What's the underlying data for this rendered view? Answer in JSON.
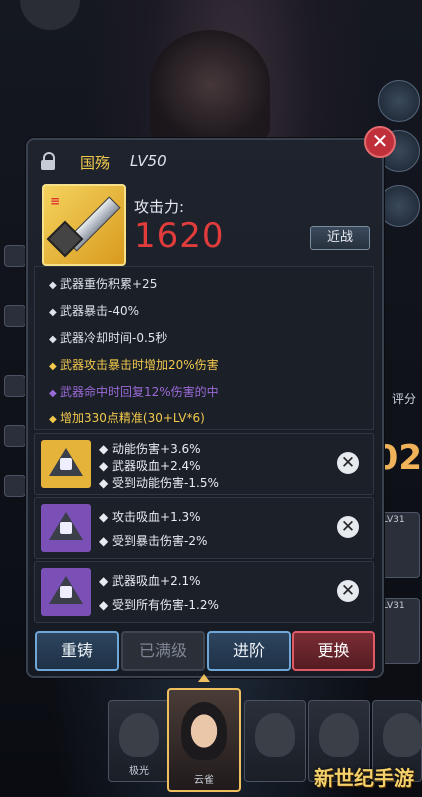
{
  "weapon": {
    "name": "国殇",
    "level": "LV50",
    "attack_label": "攻击力:",
    "attack_value": "1620",
    "type_badge": "近战"
  },
  "attributes": [
    {
      "text": "武器重伤积累+25",
      "color": "#dfe3ea",
      "bullet": "◆"
    },
    {
      "text": "武器暴击-40%",
      "color": "#dfe3ea",
      "bullet": "◆"
    },
    {
      "text": "武器冷却时间-0.5秒",
      "color": "#dfe3ea",
      "bullet": "◆"
    },
    {
      "text": "武器攻击暴击时增加20%伤害",
      "color": "#f2c94c",
      "bullet": "◆"
    },
    {
      "text": "武器命中时回复12%伤害的中",
      "color": "#9b6ad6",
      "bullet": "◆"
    },
    {
      "text": "增加330点精准(30+LV*6)",
      "color": "#f2c94c",
      "bullet": "◆"
    }
  ],
  "gems": [
    {
      "color": "#e6b33a",
      "lines": [
        "动能伤害+3.6%",
        "武器吸血+2.4%",
        "受到动能伤害-1.5%"
      ]
    },
    {
      "color": "#7a4fb6",
      "lines": [
        "攻击吸血+1.3%",
        "受到暴击伤害-2%"
      ]
    },
    {
      "color": "#7a4fb6",
      "lines": [
        "武器吸血+2.1%",
        "受到所有伤害-1.2%"
      ]
    }
  ],
  "buttons": {
    "recast": "重铸",
    "maxed": "已满级",
    "advance": "进阶",
    "replace": "更换"
  },
  "right_panel": {
    "score_label": "评分",
    "score_value": "02",
    "card_levels": [
      "LV31",
      "LV31"
    ]
  },
  "heroes": [
    {
      "name": "极光"
    },
    {
      "name": "云雀"
    },
    {
      "name": ""
    },
    {
      "name": ""
    },
    {
      "name": ""
    }
  ],
  "watermark": "新世纪手游"
}
